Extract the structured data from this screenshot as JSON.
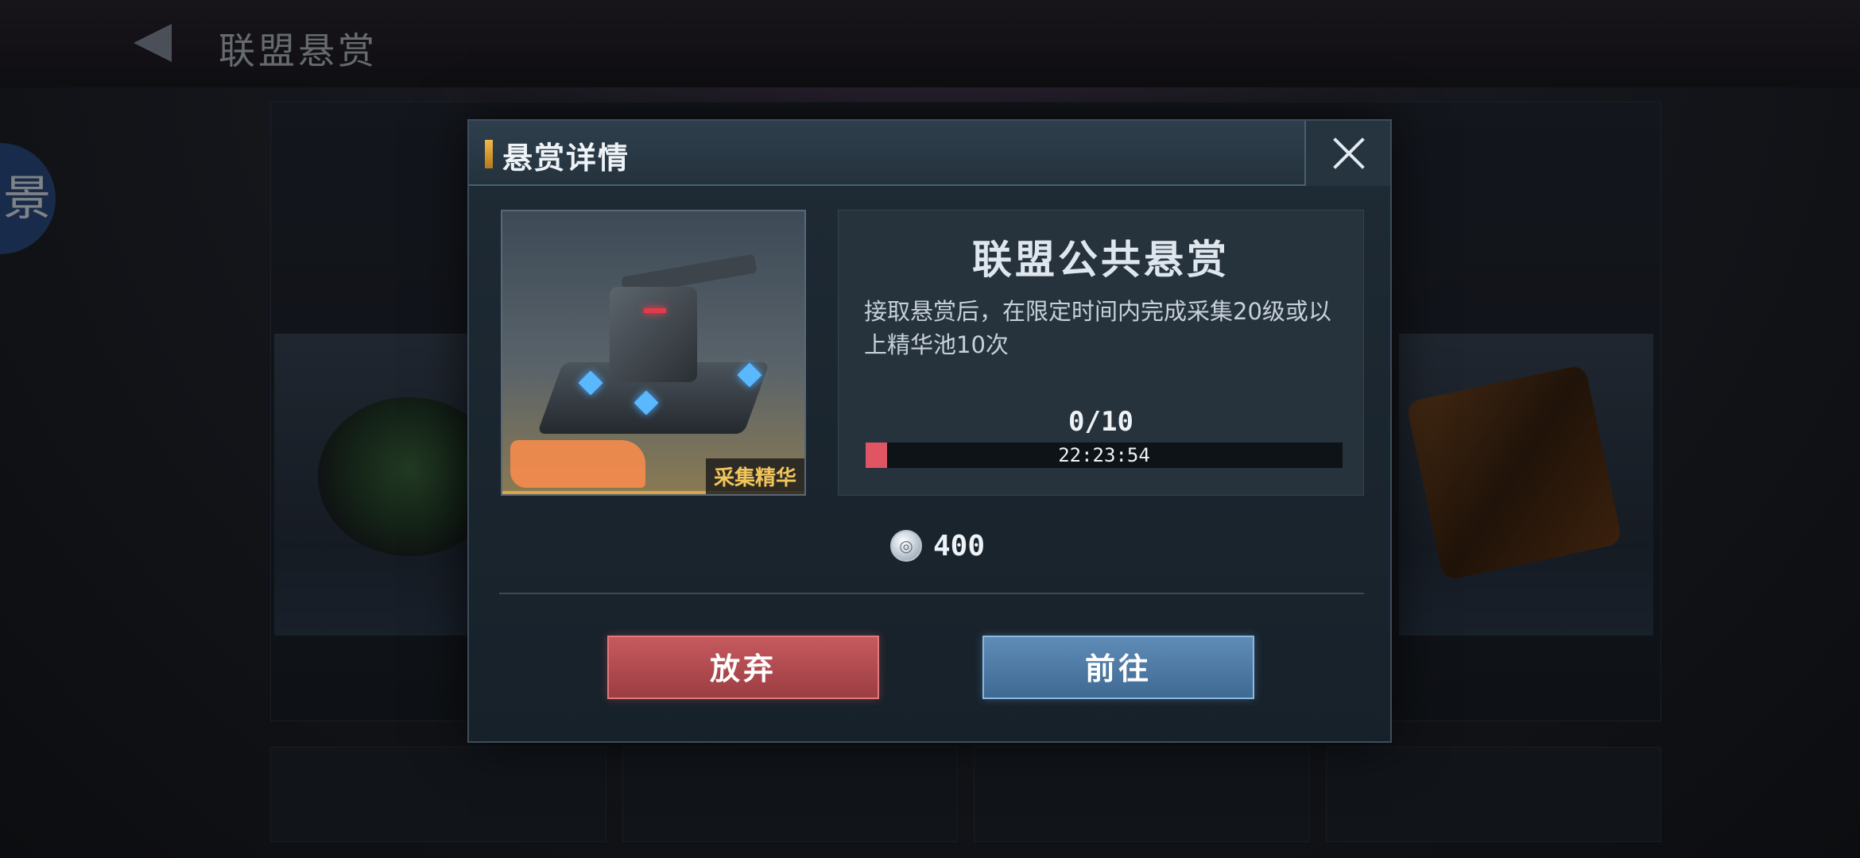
{
  "background": {
    "screen_title": "联盟悬赏",
    "side_bubble_char": "景"
  },
  "modal": {
    "title": "悬赏详情",
    "item_tag": "采集精华",
    "bounty_title": "联盟公共悬赏",
    "description": "接取悬赏后，在限定时间内完成采集20级或以上精华池10次",
    "progress": {
      "count_text": "0/10",
      "timer": "22:23:54",
      "fill_fraction": 0.045,
      "fill_color": "#e05564"
    },
    "reward": {
      "icon": "coin-icon",
      "amount": "400"
    },
    "buttons": {
      "abandon": "放弃",
      "goto": "前往"
    }
  },
  "colors": {
    "abandon_button": "#b34a4f",
    "goto_button": "#4f7ba5",
    "tag_text": "#f2c55a"
  }
}
